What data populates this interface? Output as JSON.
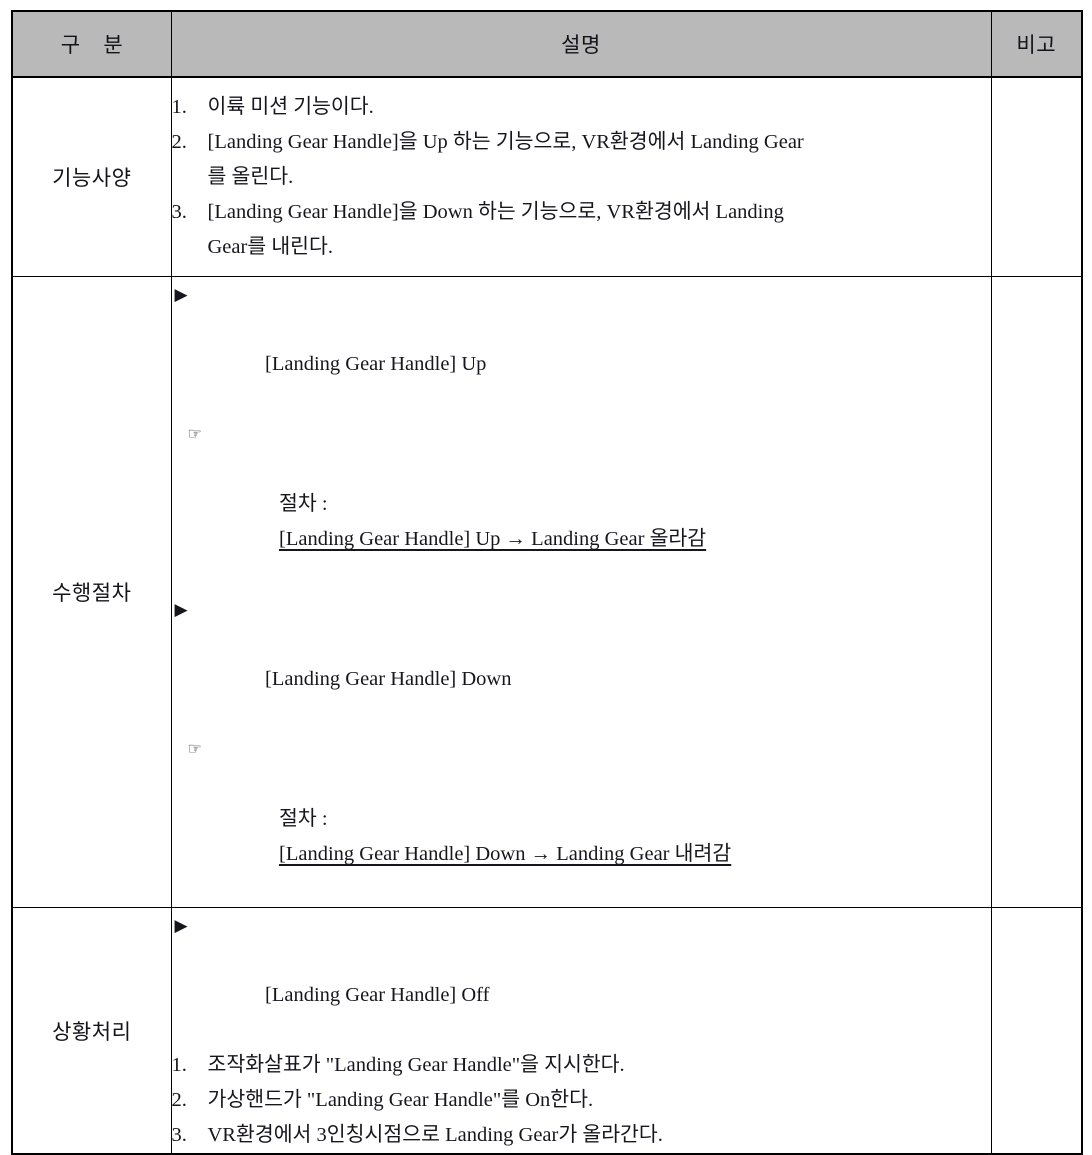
{
  "table": {
    "columns": [
      {
        "key": "label",
        "header": "구  분"
      },
      {
        "key": "desc",
        "header": "설명"
      },
      {
        "key": "remark",
        "header": "비고"
      }
    ],
    "header_background": "#b9b9b9",
    "border_color": "#000000",
    "rows": [
      {
        "label": "기능사양",
        "remark": "",
        "items": [
          {
            "type": "numbered",
            "marker": "1.",
            "text": "이륙 미션 기능이다."
          },
          {
            "type": "numbered",
            "marker": "2.",
            "text": "[Landing Gear Handle]을 Up 하는 기능으로, VR환경에서 Landing Gear",
            "continuation": "를 올린다."
          },
          {
            "type": "numbered",
            "marker": "3.",
            "text": "[Landing Gear Handle]을 Down 하는 기능으로, VR환경에서 Landing",
            "continuation": "Gear를 내린다."
          }
        ]
      },
      {
        "label": "수행절차",
        "remark": "",
        "items": [
          {
            "type": "bullet",
            "marker": "▶",
            "text": "[Landing Gear Handle] Up"
          },
          {
            "type": "procedure",
            "marker": "☞",
            "label": "절차 : ",
            "value": "[Landing Gear Handle] Up → Landing Gear 올라감"
          },
          {
            "type": "bullet",
            "marker": "▶",
            "text": "[Landing Gear Handle] Down"
          },
          {
            "type": "procedure",
            "marker": "☞",
            "label": "절차 : ",
            "value": "[Landing Gear Handle] Down → Landing Gear 내려감"
          }
        ]
      },
      {
        "label": "상황처리",
        "remark": "",
        "items": [
          {
            "type": "bullet",
            "marker": "▶",
            "text": "[Landing Gear Handle] Off"
          },
          {
            "type": "numbered",
            "marker": "1.",
            "text": "조작화살표가 \"Landing Gear Handle\"을 지시한다."
          },
          {
            "type": "numbered",
            "marker": "2.",
            "text": "가상핸드가 \"Landing Gear Handle\"를 On한다."
          },
          {
            "type": "numbered",
            "marker": "3.",
            "text": "VR환경에서 3인칭시점으로 Landing Gear가 올라간다."
          }
        ]
      }
    ]
  }
}
